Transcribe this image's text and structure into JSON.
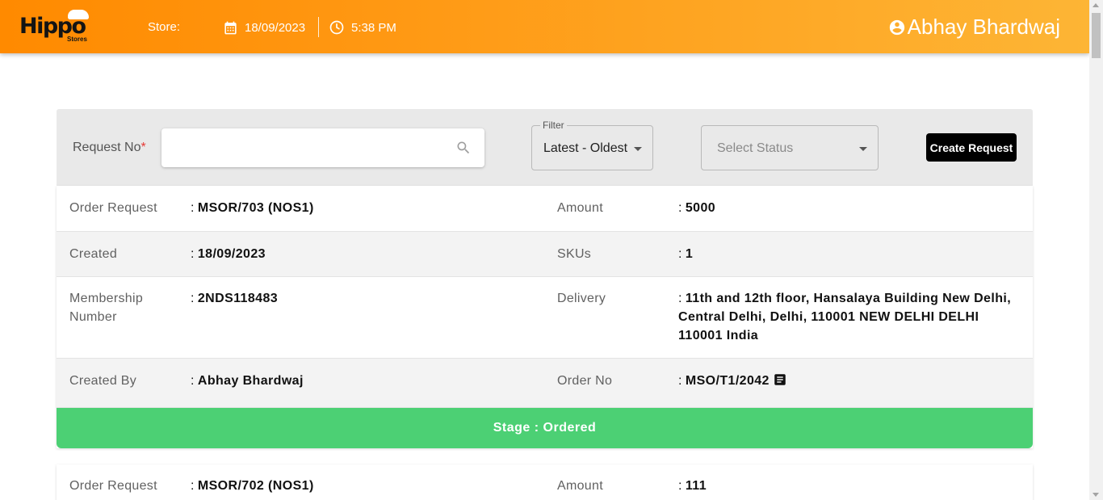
{
  "header": {
    "logo_text": "Hippo",
    "logo_sub": "Stores",
    "store_label": "Store:",
    "date": "18/09/2023",
    "time": "5:38 PM",
    "user_name": "Abhay Bhardwaj"
  },
  "filters": {
    "request_label": "Request No",
    "required_mark": "*",
    "search_value": "",
    "filter_legend": "Filter",
    "filter_value": "Latest - Oldest",
    "status_placeholder": "Select Status",
    "create_button": "Create Request"
  },
  "orders": [
    {
      "order_request_label": "Order Request",
      "order_request": "MSOR/703 (NOS1)",
      "amount_label": "Amount",
      "amount": "5000",
      "created_label": "Created",
      "created": "18/09/2023",
      "skus_label": "SKUs",
      "skus": "1",
      "membership_label": "Membership Number",
      "membership": "2NDS118483",
      "delivery_label": "Delivery",
      "delivery": "11th and 12th floor, Hansalaya Building New Delhi, Central Delhi, Delhi, 110001 NEW DELHI DELHI 110001 India",
      "created_by_label": "Created By",
      "created_by": "Abhay Bhardwaj",
      "order_no_label": "Order No",
      "order_no": "MSO/T1/2042",
      "stage": "Stage : Ordered"
    },
    {
      "order_request_label": "Order Request",
      "order_request": "MSOR/702 (NOS1)",
      "amount_label": "Amount",
      "amount": "111"
    }
  ],
  "colon": ":",
  "colors": {
    "header_start": "#ff8a00",
    "header_end": "#fdb535",
    "stage_ordered": "#4cd074",
    "button": "#000000"
  },
  "icons": [
    "calendar-icon",
    "clock-icon",
    "user-circle-icon",
    "search-icon",
    "chevron-down-icon",
    "document-icon"
  ]
}
